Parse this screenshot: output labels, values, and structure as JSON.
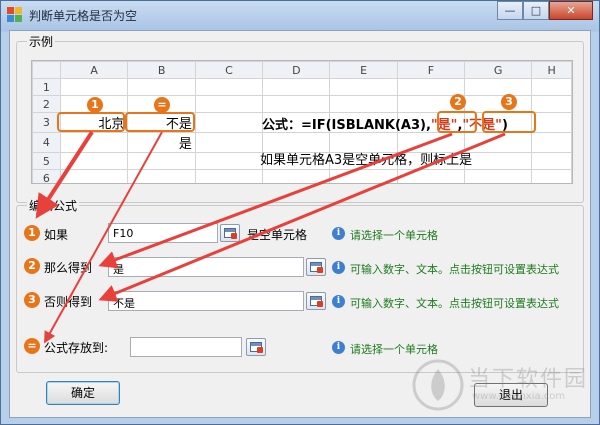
{
  "window": {
    "title": "判断单元格是否为空",
    "minimize_icon": "minimize-icon",
    "maximize_icon": "maximize-icon",
    "close_icon": "close-icon"
  },
  "example": {
    "legend": "示例",
    "columns": [
      "A",
      "B",
      "C",
      "D",
      "E",
      "F",
      "G",
      "H"
    ],
    "rows": [
      "1",
      "2",
      "3",
      "4",
      "5",
      "6"
    ],
    "cells": {
      "A3": "北京",
      "B3": "不是",
      "B4": "是"
    },
    "badges": [
      "1",
      "=",
      "2",
      "3"
    ],
    "formula": {
      "prefix": "公式：=IF(ISBLANK(A3),",
      "q1": "\"是\"",
      "sep": ",",
      "q2": "\"不是\"",
      "suffix": ")"
    },
    "explanation": "如果单元格A3是空单元格，则标上是"
  },
  "edit": {
    "legend": "编辑公式",
    "badges": [
      "1",
      "2",
      "3",
      "="
    ],
    "if_label": "如果",
    "if_value": "F10",
    "if_suffix": "是空单元格",
    "then_label": "那么得到",
    "then_value": "是",
    "else_label": "否则得到",
    "else_value": "不是",
    "store_label": "公式存放到:",
    "store_value": "",
    "hint_select": "请选择一个单元格",
    "hint_input": "可输入数字、文本。点击按钮可设置表达式",
    "hint_input2": "可输入数字、文本。点击按钮可设置表达式",
    "hint_select2": "请选择一个单元格"
  },
  "buttons": {
    "ok": "确定",
    "exit": "退出"
  },
  "watermark": {
    "text": "当下软件园",
    "url": "www.downxia.com"
  },
  "colors": {
    "accent": "#e8751a",
    "arrow": "#e8403a",
    "hint": "#1f7a1f",
    "info": "#3f7fd1"
  }
}
